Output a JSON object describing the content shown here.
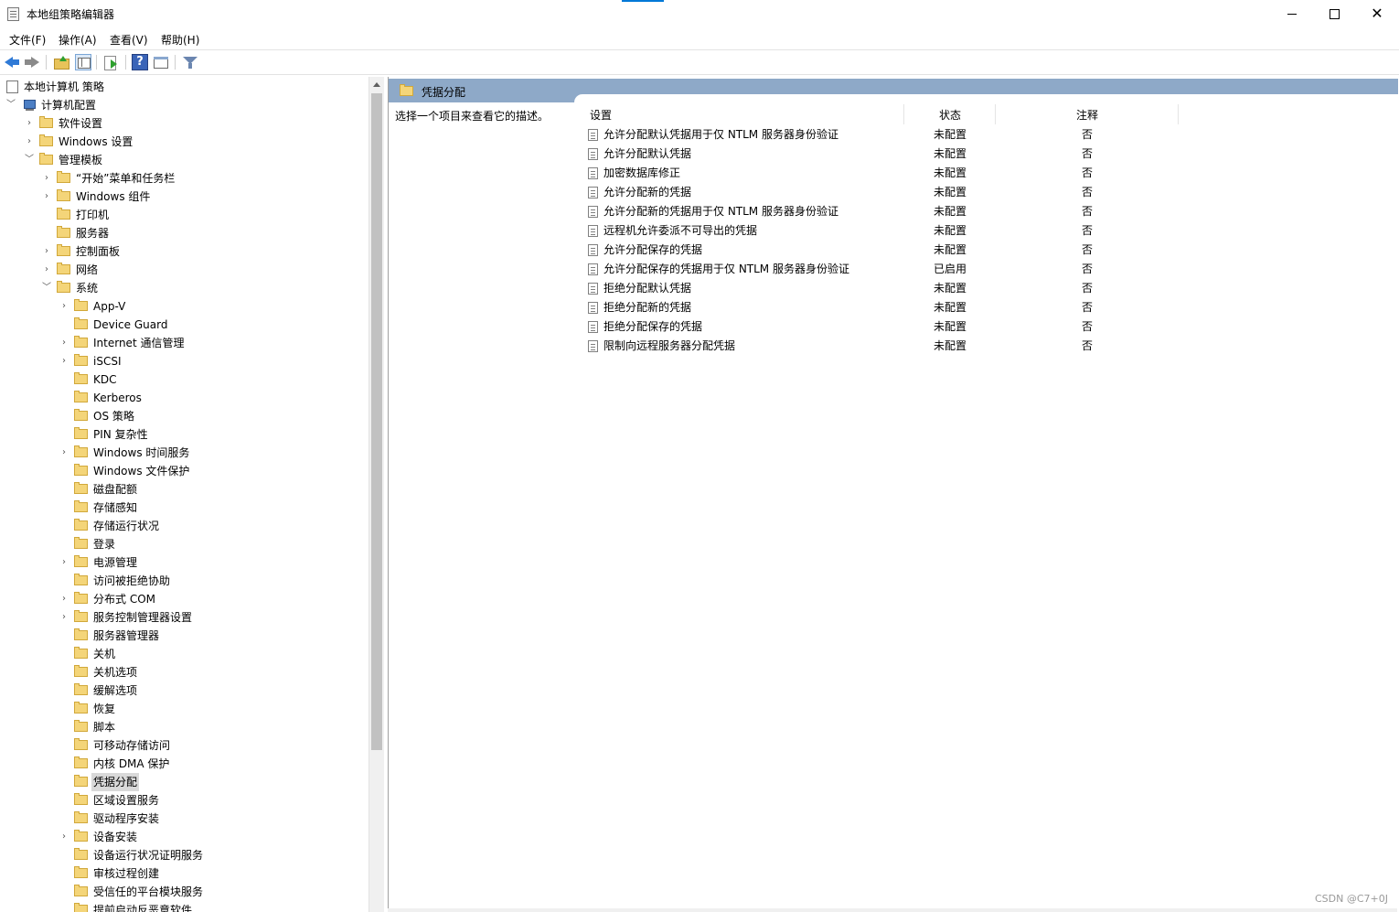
{
  "window": {
    "title": "本地组策略编辑器"
  },
  "menu": [
    "文件(F)",
    "操作(A)",
    "查看(V)",
    "帮助(H)"
  ],
  "toolbar": {
    "icons": [
      "back-arrow-icon",
      "forward-arrow-icon",
      "folder-up-icon",
      "show-hide-tree-icon",
      "export-list-icon",
      "help-icon",
      "properties-icon",
      "filter-icon"
    ]
  },
  "tree": {
    "root": "本地计算机 策略",
    "computer_config": "计算机配置",
    "software_settings": "软件设置",
    "windows_settings": "Windows 设置",
    "admin_templates": "管理模板",
    "start_menu": "“开始”菜单和任务栏",
    "windows_components": "Windows 组件",
    "printers": "打印机",
    "server": "服务器",
    "control_panel": "控制面板",
    "network": "网络",
    "system": "系统",
    "system_items": [
      {
        "label": "App-V",
        "expandable": true
      },
      {
        "label": "Device Guard",
        "expandable": false
      },
      {
        "label": "Internet 通信管理",
        "expandable": true
      },
      {
        "label": "iSCSI",
        "expandable": true
      },
      {
        "label": "KDC",
        "expandable": false
      },
      {
        "label": "Kerberos",
        "expandable": false
      },
      {
        "label": "OS 策略",
        "expandable": false
      },
      {
        "label": "PIN 复杂性",
        "expandable": false
      },
      {
        "label": "Windows 时间服务",
        "expandable": true
      },
      {
        "label": "Windows 文件保护",
        "expandable": false
      },
      {
        "label": "磁盘配额",
        "expandable": false
      },
      {
        "label": "存储感知",
        "expandable": false
      },
      {
        "label": "存储运行状况",
        "expandable": false
      },
      {
        "label": "登录",
        "expandable": false
      },
      {
        "label": "电源管理",
        "expandable": true
      },
      {
        "label": "访问被拒绝协助",
        "expandable": false
      },
      {
        "label": "分布式 COM",
        "expandable": true
      },
      {
        "label": "服务控制管理器设置",
        "expandable": true
      },
      {
        "label": "服务器管理器",
        "expandable": false
      },
      {
        "label": "关机",
        "expandable": false
      },
      {
        "label": "关机选项",
        "expandable": false
      },
      {
        "label": "缓解选项",
        "expandable": false
      },
      {
        "label": "恢复",
        "expandable": false
      },
      {
        "label": "脚本",
        "expandable": false
      },
      {
        "label": "可移动存储访问",
        "expandable": false
      },
      {
        "label": "内核 DMA 保护",
        "expandable": false
      },
      {
        "label": "凭据分配",
        "expandable": false,
        "selected": true
      },
      {
        "label": "区域设置服务",
        "expandable": false
      },
      {
        "label": "驱动程序安装",
        "expandable": false
      },
      {
        "label": "设备安装",
        "expandable": true
      },
      {
        "label": "设备运行状况证明服务",
        "expandable": false
      },
      {
        "label": "审核过程创建",
        "expandable": false
      },
      {
        "label": "受信任的平台模块服务",
        "expandable": false
      },
      {
        "label": "提前启动反恶意软件",
        "expandable": false
      }
    ]
  },
  "panel": {
    "title": "凭据分配",
    "description": "选择一个项目来查看它的描述。",
    "columns": [
      "设置",
      "状态",
      "注释"
    ],
    "rows": [
      {
        "setting": "允许分配默认凭据用于仅 NTLM 服务器身份验证",
        "state": "未配置",
        "comment": "否"
      },
      {
        "setting": "允许分配默认凭据",
        "state": "未配置",
        "comment": "否"
      },
      {
        "setting": "加密数据库修正",
        "state": "未配置",
        "comment": "否"
      },
      {
        "setting": "允许分配新的凭据",
        "state": "未配置",
        "comment": "否"
      },
      {
        "setting": "允许分配新的凭据用于仅 NTLM 服务器身份验证",
        "state": "未配置",
        "comment": "否"
      },
      {
        "setting": "远程机允许委派不可导出的凭据",
        "state": "未配置",
        "comment": "否"
      },
      {
        "setting": "允许分配保存的凭据",
        "state": "未配置",
        "comment": "否"
      },
      {
        "setting": "允许分配保存的凭据用于仅 NTLM 服务器身份验证",
        "state": "已启用",
        "comment": "否"
      },
      {
        "setting": "拒绝分配默认凭据",
        "state": "未配置",
        "comment": "否"
      },
      {
        "setting": "拒绝分配新的凭据",
        "state": "未配置",
        "comment": "否"
      },
      {
        "setting": "拒绝分配保存的凭据",
        "state": "未配置",
        "comment": "否"
      },
      {
        "setting": "限制向远程服务器分配凭据",
        "state": "未配置",
        "comment": "否"
      }
    ]
  },
  "watermark": "CSDN @C7+0J",
  "colors": {
    "header_bar": "#8ea9c8",
    "accent": "#0078d7",
    "selection": "#d9d9d9"
  }
}
